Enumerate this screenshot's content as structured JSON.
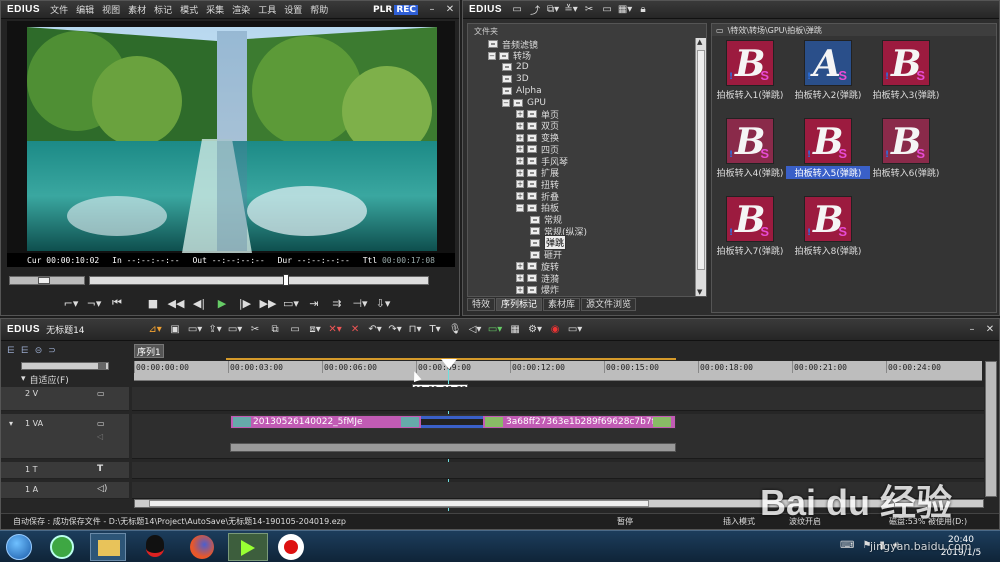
{
  "player": {
    "brand": "EDIUS",
    "menu": [
      "文件",
      "编辑",
      "视图",
      "素材",
      "标记",
      "模式",
      "采集",
      "渲染",
      "工具",
      "设置",
      "帮助"
    ],
    "plr": "PLR",
    "rec": "REC",
    "cur": "Cur 00:00:10:02",
    "in": "In --:--:--:--",
    "out": "Out --:--:--:--",
    "dur": "Dur --:--:--:--",
    "ttl_label": "Ttl",
    "ttl": "00:00:17:08"
  },
  "library": {
    "brand": "EDIUS",
    "folder_header": "文件夹",
    "path": "\\特效\\转场\\GPU\\拍板\\弹跳",
    "tree": [
      {
        "label": "音频滤镜"
      },
      {
        "label": "转场"
      },
      {
        "label": "2D"
      },
      {
        "label": "3D"
      },
      {
        "label": "Alpha"
      },
      {
        "label": "GPU"
      },
      {
        "label": "单页"
      },
      {
        "label": "双页"
      },
      {
        "label": "变换"
      },
      {
        "label": "四页"
      },
      {
        "label": "手风琴"
      },
      {
        "label": "扩展"
      },
      {
        "label": "扭转"
      },
      {
        "label": "折叠"
      },
      {
        "label": "拍板"
      },
      {
        "label": "常规"
      },
      {
        "label": "常规(纵深)"
      },
      {
        "label": "弹跳"
      },
      {
        "label": "砸开"
      },
      {
        "label": "旋转"
      },
      {
        "label": "涟漪"
      },
      {
        "label": "爆炸"
      }
    ],
    "tabs": [
      "特效",
      "序列标记",
      "素材库",
      "源文件浏览"
    ],
    "effects": [
      {
        "label": "拍板转入1(弹跳)",
        "letter": "B"
      },
      {
        "label": "拍板转入2(弹跳)",
        "letter": "A"
      },
      {
        "label": "拍板转入3(弹跳)",
        "letter": "B"
      },
      {
        "label": "拍板转入4(弹跳)",
        "letter": "B"
      },
      {
        "label": "拍板转入5(弹跳)",
        "letter": "B"
      },
      {
        "label": "拍板转入6(弹跳)",
        "letter": "B"
      },
      {
        "label": "拍板转入7(弹跳)",
        "letter": "B"
      },
      {
        "label": "拍板转入8(弹跳)",
        "letter": "B"
      }
    ]
  },
  "timeline": {
    "brand": "EDIUS",
    "project": "无标题14",
    "sequence_tab": "序列1",
    "fit_label": "自适应(F)",
    "ruler": [
      "00:00:00:00",
      "00:00:03:00",
      "00:00:06:00",
      "00:00:09:00",
      "00:00:12:00",
      "00:00:15:00",
      "00:00:18:00",
      "00:00:21:00",
      "00:00:24:00"
    ],
    "playhead_tooltip": "00:00:08:23",
    "tracks": [
      {
        "name": "2 V"
      },
      {
        "name": "1 VA"
      },
      {
        "name": "1 T"
      },
      {
        "name": "1 A"
      }
    ],
    "clip1": "20130526140022_5fMJe",
    "clip2": "3a68ff27363e1b289f69628c7b7f..."
  },
  "status": {
    "autosave": "自动保存 : 成功保存文件 - D:\\无标题14\\Project\\AutoSave\\无标题14-190105-204019.ezp",
    "pause": "暂停",
    "insert": "插入模式",
    "ripple": "波纹开启",
    "disk": "磁盘:53% 被使用(D:)"
  },
  "taskbar": {
    "time": "20:40",
    "date": "2019/1/5"
  },
  "watermark": {
    "brand": "Bai du 经验",
    "url": "jingyan.baidu.com"
  }
}
